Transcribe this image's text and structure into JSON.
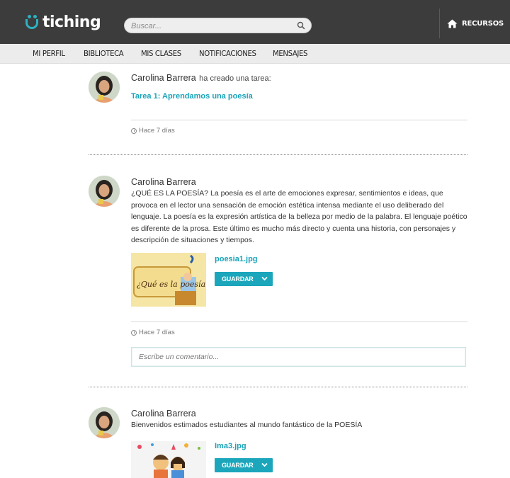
{
  "header": {
    "logo_text": "tiching",
    "search_placeholder": "Buscar...",
    "recursos_label": "RECURSOS",
    "accent": "#2fb0c3"
  },
  "nav": {
    "items": [
      "MI PERFIL",
      "BIBLIOTECA",
      "MIS CLASES",
      "NOTIFICACIONES",
      "MENSAJES"
    ]
  },
  "feed": {
    "post1": {
      "author": "Carolina Barrera",
      "action": "ha creado una tarea:",
      "task_link": "Tarea 1: Aprendamos una poesía",
      "time": "Hace 7 días"
    },
    "post2": {
      "author": "Carolina Barrera",
      "text": "¿QUÉ ES LA POESÍA? La poesía es el arte de emociones expresar, sentimientos e ideas, que provoca en el lector una sensación de emoción estética intensa mediante el uso deliberado del lenguaje. La poesía es la expresión artística de la belleza por medio de la palabra. El lenguaje poético es diferente de la prosa. Este último es mucho más directo y cuenta una historia, con personajes y descripción de situaciones y tiempos.",
      "attachment_name": "poesia1.jpg",
      "thumb_caption": "¿Qué es la poesía?",
      "save_label": "GUARDAR",
      "time": "Hace 7 días",
      "comment_placeholder": "Escribe un comentario..."
    },
    "post3": {
      "author": "Carolina Barrera",
      "text": "Bienvenidos estimados estudiantes al mundo fantástico de la POESÍA",
      "attachment_name": "Ima3.jpg",
      "save_label": "GUARDAR"
    }
  }
}
